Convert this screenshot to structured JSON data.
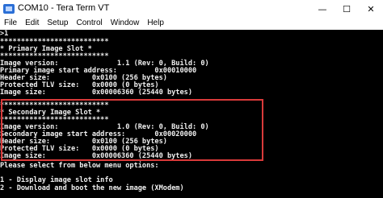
{
  "window": {
    "title": "COM10 - Tera Term VT",
    "controls": {
      "minimize": "—",
      "maximize": "☐",
      "close": "✕"
    }
  },
  "menu": [
    "File",
    "Edit",
    "Setup",
    "Control",
    "Window",
    "Help"
  ],
  "terminal": {
    "lines": [
      ">1",
      "**************************",
      "* Primary Image Slot *",
      "**************************",
      "Image version:              1.1 (Rev: 0, Build: 0)",
      "Primary image start address:         0x00010000",
      "Header size:          0x0100 (256 bytes)",
      "Protected TLV size:   0x0000 (0 bytes)",
      "Image size:           0x00006360 (25440 bytes)",
      "",
      "**************************",
      "* Secondary Image Slot *",
      "**************************",
      "Image version:              1.0 (Rev: 0, Build: 0)",
      "Secondary image start address:       0x00020000",
      "Header size:          0x0100 (256 bytes)",
      "Protected TLV size:   0x0000 (0 bytes)",
      "Image size:           0x00006360 (25440 bytes)",
      "",
      "Please select from below menu options:",
      "",
      "1 - Display image slot info",
      "2 - Download and boot the new image (XModem)"
    ]
  },
  "colors": {
    "terminal_bg": "#000000",
    "terminal_fg": "#f0f0f0",
    "highlight_border": "#d93a3a"
  }
}
